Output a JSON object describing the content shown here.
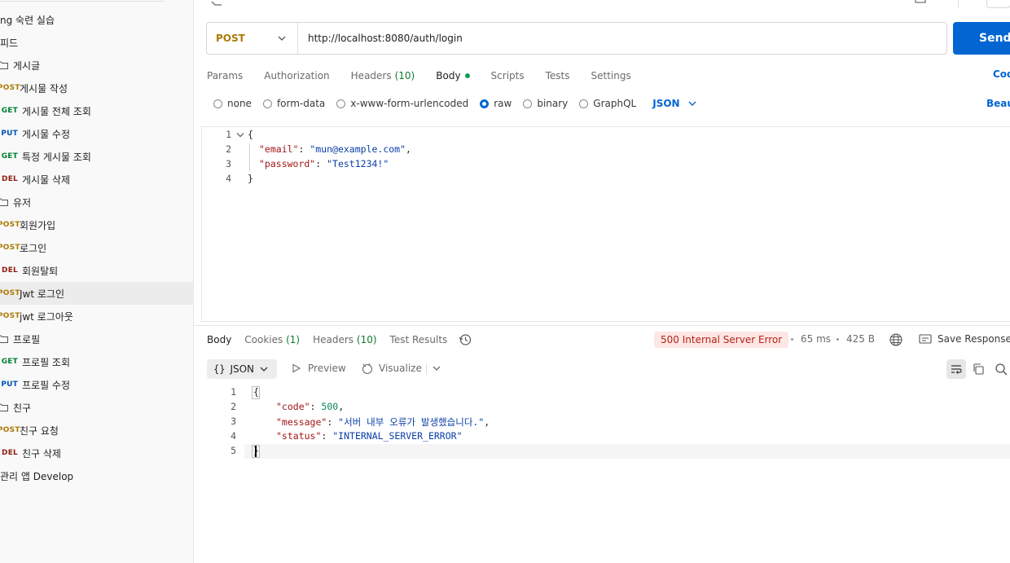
{
  "sidebar": {
    "items": [
      {
        "method": "",
        "label": "ng 숙련 실습",
        "kind": "text"
      },
      {
        "method": "",
        "label": "피드",
        "kind": "text"
      },
      {
        "method": "",
        "label": "게시글",
        "kind": "folder"
      },
      {
        "method": "POST",
        "label": "게시물 작성",
        "kind": "request"
      },
      {
        "method": "GET",
        "label": "게시물 전체 조회",
        "kind": "request"
      },
      {
        "method": "PUT",
        "label": "게시물 수정",
        "kind": "request"
      },
      {
        "method": "GET",
        "label": "특정 게시물 조회",
        "kind": "request"
      },
      {
        "method": "DEL",
        "label": "게시물 삭제",
        "kind": "request"
      },
      {
        "method": "",
        "label": "유저",
        "kind": "folder"
      },
      {
        "method": "POST",
        "label": "회원가입",
        "kind": "request"
      },
      {
        "method": "POST",
        "label": "로그인",
        "kind": "request"
      },
      {
        "method": "DEL",
        "label": "회원탈퇴",
        "kind": "request"
      },
      {
        "method": "POST",
        "label": "Jwt 로그인",
        "kind": "request",
        "selected": true
      },
      {
        "method": "POST",
        "label": "jwt 로그아웃",
        "kind": "request"
      },
      {
        "method": "",
        "label": "프로필",
        "kind": "folder"
      },
      {
        "method": "GET",
        "label": "프로필 조회",
        "kind": "request"
      },
      {
        "method": "PUT",
        "label": "프로필 수정",
        "kind": "request"
      },
      {
        "method": "",
        "label": "친구",
        "kind": "folder"
      },
      {
        "method": "POST",
        "label": "친구 요청",
        "kind": "request"
      },
      {
        "method": "DEL",
        "label": "친구 삭제",
        "kind": "request"
      },
      {
        "method": "",
        "label": "관리 앱 Develop",
        "kind": "text"
      }
    ]
  },
  "method_colors": {
    "POST": "#ad7a03",
    "GET": "#007f31",
    "PUT": "#0053b8",
    "DEL": "#8e1a10"
  },
  "request": {
    "method": "POST",
    "url": "http://localhost:8080/auth/login",
    "send_label": "Send"
  },
  "tabs": [
    {
      "label": "Params"
    },
    {
      "label": "Authorization"
    },
    {
      "label": "Headers",
      "count": "(10)"
    },
    {
      "label": "Body",
      "active": true,
      "dot": true
    },
    {
      "label": "Scripts"
    },
    {
      "label": "Tests"
    },
    {
      "label": "Settings"
    }
  ],
  "cookies_link": "Coo",
  "body_types": [
    {
      "label": "none"
    },
    {
      "label": "form-data"
    },
    {
      "label": "x-www-form-urlencoded"
    },
    {
      "label": "raw",
      "selected": true
    },
    {
      "label": "binary"
    },
    {
      "label": "GraphQL"
    }
  ],
  "body_format": "JSON",
  "beautify_link": "Beau",
  "request_body": {
    "line_numbers": [
      "1",
      "2",
      "3",
      "4"
    ],
    "email_key": "\"email\"",
    "email_value": "\"mun@example.com\"",
    "password_key": "\"password\"",
    "password_value": "\"Test1234!\""
  },
  "response_tabs": [
    {
      "label": "Body",
      "active": true
    },
    {
      "label": "Cookies",
      "count": "(1)"
    },
    {
      "label": "Headers",
      "count": "(10)"
    },
    {
      "label": "Test Results"
    }
  ],
  "response_meta": {
    "status": "500 Internal Server Error",
    "time": "65 ms",
    "size": "425 B",
    "save_label": "Save Response"
  },
  "response_toolbar": {
    "format": "JSON",
    "preview": "Preview",
    "visualize": "Visualize"
  },
  "response_body": {
    "line_numbers": [
      "1",
      "2",
      "3",
      "4",
      "5"
    ],
    "code_key": "\"code\"",
    "code_value": "500",
    "message_key": "\"message\"",
    "message_value": "\"서버 내부 오류가 발생했습니다.\"",
    "status_key": "\"status\"",
    "status_value": "\"INTERNAL_SERVER_ERROR\""
  }
}
